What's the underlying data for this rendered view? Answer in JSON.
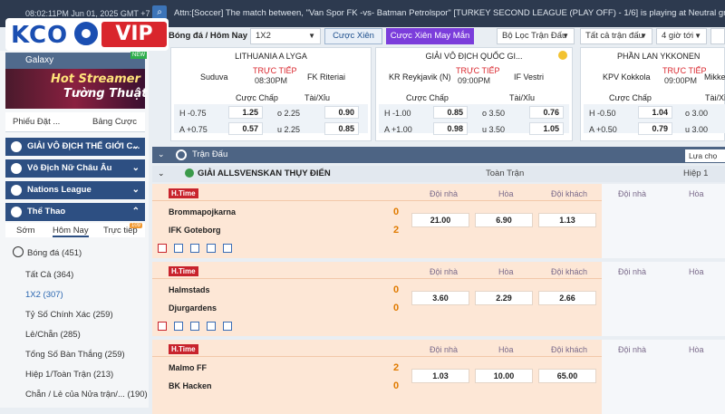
{
  "topbar": {
    "time": "08:02:11PM Jun 01, 2025 GMT +7",
    "ticker": "Attn:[Soccer] The match between, \"Van Spor FK -vs- Batman Petrolspor\" [TURKEY SECOND LEAGUE (PLAY OFF) - 1/6] is playing at Neutral ground. all bets"
  },
  "logo": {
    "left": "KCO",
    "right": "VIP"
  },
  "sidebar": {
    "galaxy": "Galaxy",
    "promo_line1": "Hot Streamer",
    "promo_line2": "Tường Thuật",
    "promo_badge": "NEW",
    "tabs1": [
      "Phiếu Đặt ...",
      "Bảng Cược"
    ],
    "sections": [
      "GIẢI VÔ ĐỊCH THẾ GIỚI C...",
      "Vô Địch Nữ Châu Âu",
      "Nations League",
      "Thể Thao"
    ],
    "tabs2": [
      "Sớm",
      "Hôm Nay",
      "Trực tiếp"
    ],
    "live_count": "109",
    "football": "Bóng đá (451)",
    "items": [
      "Tất Cả (364)",
      "1X2 (307)",
      "Tỷ Số Chính Xác (259)",
      "Lẻ/Chẵn (285)",
      "Tổng Số Bàn Thắng (259)",
      "Hiệp 1/Toàn Trận (213)",
      "Chẵn / Lẻ của Nửa trận/...  (190)"
    ]
  },
  "filters": {
    "crumb": "Bóng đá / Hôm Nay",
    "market": "1X2",
    "xien": "Cược Xiên",
    "xien_mm": "Cược Xiên May Mắn",
    "filter": "Bộ Lọc Trận Đấu",
    "all_matches": "Tất cả trận đấu",
    "hours": "4 giờ tới"
  },
  "cards": [
    {
      "league": "LITHUANIA A LYGA",
      "home": "Suduva",
      "away": "FK Riteriai",
      "live": "TRỰC TIẾP",
      "time": "08:30PM",
      "h_hcp": "H -0.75",
      "h_hcp_odds": "1.25",
      "h_ou": "o 2.25",
      "h_ou_odds": "0.90",
      "a_hcp": "A +0.75",
      "a_hcp_odds": "0.57",
      "a_ou": "u 2.25",
      "a_ou_odds": "0.85"
    },
    {
      "league": "GIẢI VÔ ĐỊCH QUỐC GI...",
      "home": "KR Reykjavik (N)",
      "away": "IF Vestri",
      "live": "TRỰC TIẾP",
      "time": "09:00PM",
      "h_hcp": "H -1.00",
      "h_hcp_odds": "0.85",
      "h_ou": "o 3.50",
      "h_ou_odds": "0.76",
      "a_hcp": "A +1.00",
      "a_hcp_odds": "0.98",
      "a_ou": "u 3.50",
      "a_ou_odds": "1.05"
    },
    {
      "league": "PHẦN LAN YKKONEN",
      "home": "KPV Kokkola",
      "away": "Mikkel",
      "live": "TRỰC TIẾP",
      "time": "09:00PM",
      "h_hcp": "H -0.50",
      "h_hcp_odds": "1.04",
      "h_ou": "o 3.00",
      "h_ou_odds": "",
      "a_hcp": "A +0.50",
      "a_hcp_odds": "0.79",
      "a_ou": "u 3.00",
      "a_ou_odds": ""
    }
  ],
  "card_headers": {
    "hcp": "Cược Chấp",
    "ou": "Tài/Xỉu"
  },
  "list": {
    "header": "Trận Đấu",
    "select": "Lựa chọ",
    "league": "GIẢI ALLSVENSKAN THỤY ĐIỂN",
    "full": "Toàn Trận",
    "half": "Hiệp 1",
    "ht": "H.Time",
    "cols": [
      "Đội nhà",
      "Hòa",
      "Đội khách",
      "Đội nhà",
      "Hòa"
    ]
  },
  "matches": [
    {
      "home": "Brommapojkarna",
      "away": "IFK Goteborg",
      "hs": "0",
      "as": "2",
      "odds": [
        "21.00",
        "6.90",
        "1.13"
      ]
    },
    {
      "home": "Halmstads",
      "away": "Djurgardens",
      "hs": "0",
      "as": "0",
      "odds": [
        "3.60",
        "2.29",
        "2.66"
      ]
    },
    {
      "home": "Malmo FF",
      "away": "BK Hacken",
      "hs": "2",
      "as": "0",
      "odds": [
        "1.03",
        "10.00",
        "65.00"
      ]
    }
  ]
}
